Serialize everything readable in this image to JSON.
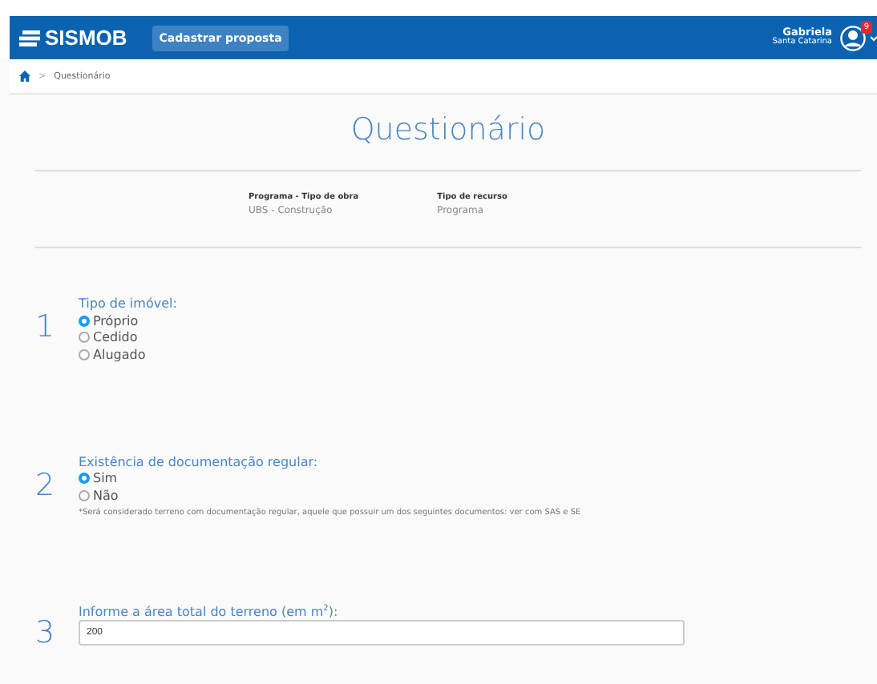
{
  "header": {
    "logo": "SISMOB",
    "action": "Cadastrar proposta",
    "user": {
      "name": "Gabriela",
      "location": "Santa Catarina",
      "badge": "9"
    }
  },
  "breadcrumb": {
    "separator": ">",
    "current": "Questionário"
  },
  "title": "Questionário",
  "info": [
    {
      "label": "Programa - Tipo de obra",
      "value": "UBS - Construção"
    },
    {
      "label": "Tipo de recurso",
      "value": "Programa"
    }
  ],
  "questions": [
    {
      "kind": "radio",
      "number": "1",
      "label": "Tipo de imóvel:",
      "options": [
        {
          "label": "Próprio",
          "selected": true
        },
        {
          "label": "Cedido",
          "selected": false
        },
        {
          "label": "Alugado",
          "selected": false
        }
      ]
    },
    {
      "kind": "radio",
      "number": "2",
      "label": "Existência de documentação regular:",
      "options": [
        {
          "label": "Sim",
          "selected": true
        },
        {
          "label": "Não",
          "selected": false
        }
      ],
      "note": "*Será considerado terreno com documentação regular, aquele que possuir um dos seguintes documentos: ver com SAS e SE"
    },
    {
      "kind": "text-input",
      "number": "3",
      "label": "Informe a área total do terreno (em m$^{2}$):",
      "value": "200"
    }
  ]
}
